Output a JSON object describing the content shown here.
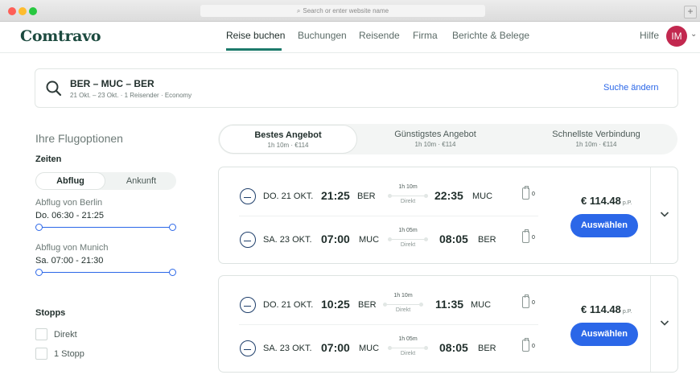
{
  "browser": {
    "url_placeholder": "Search or enter website name",
    "new_tab_label": "+"
  },
  "header": {
    "logo": "Comtravo",
    "nav": [
      "Reise buchen",
      "Buchungen",
      "Reisende",
      "Firma",
      "Berichte & Belege"
    ],
    "active_nav": "Reise buchen",
    "help": "Hilfe",
    "avatar_initials": "IM",
    "avatar_color": "#c2284f"
  },
  "search": {
    "route": "BER – MUC – BER",
    "details": "21 Okt. – 23 Okt. · 1 Reisender · Economy",
    "change_label": "Suche ändern"
  },
  "sidebar": {
    "title": "Ihre Flugoptionen",
    "times_heading": "Zeiten",
    "toggle": [
      "Abflug",
      "Ankunft"
    ],
    "ranges": [
      {
        "label": "Abflug von Berlin",
        "value": "Do. 06:30 - 21:25"
      },
      {
        "label": "Abflug von Munich",
        "value": "Sa. 07:00 - 21:30"
      }
    ],
    "stops_heading": "Stopps",
    "stops": [
      "Direkt",
      "1 Stopp"
    ]
  },
  "sort_tabs": [
    {
      "name": "Bestes Angebot",
      "meta": "1h 10m · €114"
    },
    {
      "name": "Günstigstes Angebot",
      "meta": "1h 10m · €114"
    },
    {
      "name": "Schnellste Verbindung",
      "meta": "1h 10m · €114"
    }
  ],
  "results": [
    {
      "legs": [
        {
          "date": "DO. 21 OKT.",
          "dep_time": "21:25",
          "dep_code": "BER",
          "duration": "1h 10m",
          "stops": "Direkt",
          "arr_time": "22:35",
          "arr_code": "MUC",
          "bags": "0"
        },
        {
          "date": "SA. 23 OKT.",
          "dep_time": "07:00",
          "dep_code": "MUC",
          "duration": "1h 05m",
          "stops": "Direkt",
          "arr_time": "08:05",
          "arr_code": "BER",
          "bags": "0"
        }
      ],
      "price": "€ 114.48",
      "price_unit": "p.P.",
      "select_label": "Auswählen"
    },
    {
      "legs": [
        {
          "date": "DO. 21 OKT.",
          "dep_time": "10:25",
          "dep_code": "BER",
          "duration": "1h 10m",
          "stops": "Direkt",
          "arr_time": "11:35",
          "arr_code": "MUC",
          "bags": "0"
        },
        {
          "date": "SA. 23 OKT.",
          "dep_time": "07:00",
          "dep_code": "MUC",
          "duration": "1h 05m",
          "stops": "Direkt",
          "arr_time": "08:05",
          "arr_code": "BER",
          "bags": "0"
        }
      ],
      "price": "€ 114.48",
      "price_unit": "p.P.",
      "select_label": "Auswählen"
    }
  ],
  "colors": {
    "brand": "#1c4a3f",
    "accent": "#2b67e8",
    "nav_active": "#1c7a6b"
  }
}
